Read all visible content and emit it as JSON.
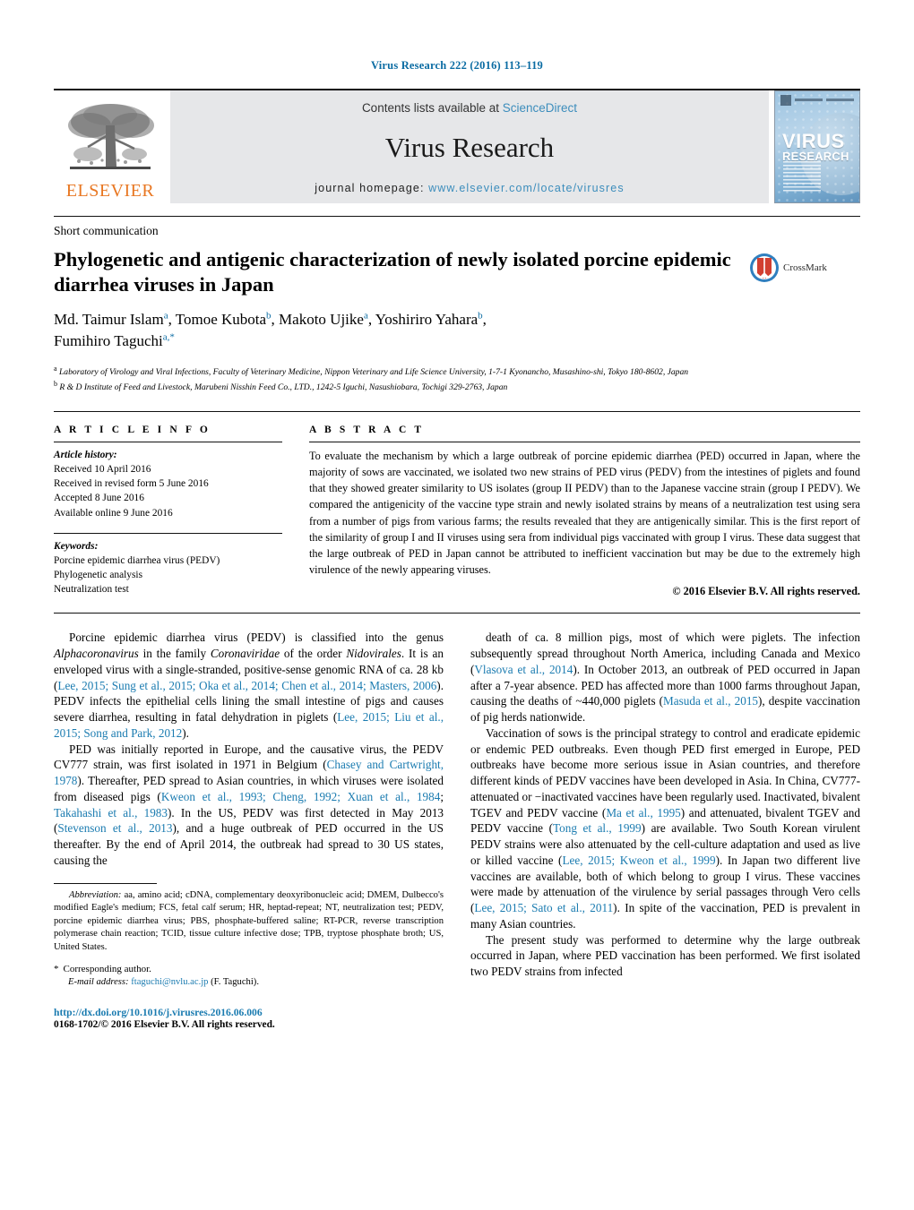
{
  "running_head": "Virus Research 222 (2016) 113–119",
  "masthead": {
    "publisher_name": "ELSEVIER",
    "contents_prefix": "Contents lists available at ",
    "contents_link": "ScienceDirect",
    "journal_title": "Virus Research",
    "homepage_prefix": "journal homepage: ",
    "homepage_link": "www.elsevier.com/locate/virusres",
    "cover_title_line1": "VIRUS",
    "cover_title_line2": "RESEARCH"
  },
  "article": {
    "doctype": "Short communication",
    "title": "Phylogenetic and antigenic characterization of newly isolated porcine epidemic diarrhea viruses in Japan",
    "crossmark_label": "CrossMark",
    "authors_line1": "Md. Taimur Islam",
    "authors_line1_sup1": "a",
    "authors_line1_b": ", Tomoe Kubota",
    "authors_line1_sup2": "b",
    "authors_line1_c": ", Makoto Ujike",
    "authors_line1_sup3": "a",
    "authors_line1_d": ", Yoshiriro Yahara",
    "authors_line1_sup4": "b",
    "authors_line1_e": ",",
    "authors_line2": "Fumihiro Taguchi",
    "authors_line2_sup": "a,*",
    "affiliation_a_sup": "a",
    "affiliation_a": "Laboratory of Virology and Viral Infections, Faculty of Veterinary Medicine, Nippon Veterinary and Life Science University, 1-7-1 Kyonancho, Musashino-shi, Tokyo 180-8602, Japan",
    "affiliation_b_sup": "b",
    "affiliation_b": "R & D Institute of Feed and Livestock, Marubeni Nisshin Feed Co., LTD., 1242-5 Iguchi, Nasushiobara, Tochigi 329-2763, Japan"
  },
  "article_info": {
    "label": "A R T I C L E    I N F O",
    "history_label": "Article history:",
    "history": [
      "Received 10 April 2016",
      "Received in revised form 5 June 2016",
      "Accepted 8 June 2016",
      "Available online 9 June 2016"
    ],
    "keywords_label": "Keywords:",
    "keywords": [
      "Porcine epidemic diarrhea virus (PEDV)",
      "Phylogenetic analysis",
      "Neutralization test"
    ]
  },
  "abstract": {
    "label": "A B S T R A C T",
    "text": "To evaluate the mechanism by which a large outbreak of porcine epidemic diarrhea (PED) occurred in Japan, where the majority of sows are vaccinated, we isolated two new strains of PED virus (PEDV) from the intestines of piglets and found that they showed greater similarity to US isolates (group II PEDV) than to the Japanese vaccine strain (group I PEDV). We compared the antigenicity of the vaccine type strain and newly isolated strains by means of a neutralization test using sera from a number of pigs from various farms; the results revealed that they are antigenically similar. This is the first report of the similarity of group I and II viruses using sera from individual pigs vaccinated with group I virus. These data suggest that the large outbreak of PED in Japan cannot be attributed to inefficient vaccination but may be due to the extremely high virulence of the newly appearing viruses.",
    "copyright": "© 2016 Elsevier B.V. All rights reserved."
  },
  "body": {
    "left": [
      {
        "parts": [
          {
            "t": "Porcine epidemic diarrhea virus (PEDV) is classified into the genus ",
            "k": "plain"
          },
          {
            "t": "Alphacoronavirus",
            "k": "ital"
          },
          {
            "t": " in the family ",
            "k": "plain"
          },
          {
            "t": "Coronaviridae",
            "k": "ital"
          },
          {
            "t": " of the order ",
            "k": "plain"
          },
          {
            "t": "Nidovirales",
            "k": "ital"
          },
          {
            "t": ". It is an enveloped virus with a single-stranded, positive-sense genomic RNA of ca. 28 kb (",
            "k": "plain"
          },
          {
            "t": "Lee, 2015; Sung et al., 2015; Oka et al., 2014; Chen et al., 2014; Masters, 2006",
            "k": "cite"
          },
          {
            "t": "). PEDV infects the epithelial cells lining the small intestine of pigs and causes severe diarrhea, resulting in fatal dehydration in piglets (",
            "k": "plain"
          },
          {
            "t": "Lee, 2015; Liu et al., 2015; Song and Park, 2012",
            "k": "cite"
          },
          {
            "t": ").",
            "k": "plain"
          }
        ]
      },
      {
        "parts": [
          {
            "t": "PED was initially reported in Europe, and the causative virus, the PEDV CV777 strain, was first isolated in 1971 in Belgium (",
            "k": "plain"
          },
          {
            "t": "Chasey and Cartwright, 1978",
            "k": "cite"
          },
          {
            "t": "). Thereafter, PED spread to Asian countries, in which viruses were isolated from diseased pigs (",
            "k": "plain"
          },
          {
            "t": "Kweon et al., 1993; Cheng, 1992; Xuan et al., 1984",
            "k": "cite"
          },
          {
            "t": "; ",
            "k": "plain"
          },
          {
            "t": "Takahashi et al., 1983",
            "k": "cite"
          },
          {
            "t": "). In the US, PEDV was first detected in May 2013 (",
            "k": "plain"
          },
          {
            "t": "Stevenson et al., 2013",
            "k": "cite"
          },
          {
            "t": "), and a huge outbreak of PED occurred in the US thereafter. By the end of April 2014, the outbreak had spread to 30 US states, causing the",
            "k": "plain"
          }
        ]
      }
    ],
    "right": [
      {
        "parts": [
          {
            "t": "death of ca. 8 million pigs, most of which were piglets. The infection subsequently spread throughout North America, including Canada and Mexico (",
            "k": "plain"
          },
          {
            "t": "Vlasova et al., 2014",
            "k": "cite"
          },
          {
            "t": "). In October 2013, an outbreak of PED occurred in Japan after a 7-year absence. PED has affected more than 1000 farms throughout Japan, causing the deaths of ~440,000 piglets (",
            "k": "plain"
          },
          {
            "t": "Masuda et al., 2015",
            "k": "cite"
          },
          {
            "t": "), despite vaccination of pig herds nationwide.",
            "k": "plain"
          }
        ],
        "noindent": false
      },
      {
        "parts": [
          {
            "t": "Vaccination of sows is the principal strategy to control and eradicate epidemic or endemic PED outbreaks. Even though PED first emerged in Europe, PED outbreaks have become more serious issue in Asian countries, and therefore different kinds of PEDV vaccines have been developed in Asia. In China, CV777-attenuated or −inactivated vaccines have been regularly used. Inactivated, bivalent TGEV and PEDV vaccine (",
            "k": "plain"
          },
          {
            "t": "Ma et al., 1995",
            "k": "cite"
          },
          {
            "t": ") and attenuated, bivalent TGEV and PEDV vaccine (",
            "k": "plain"
          },
          {
            "t": "Tong et al., 1999",
            "k": "cite"
          },
          {
            "t": ") are available. Two South Korean virulent PEDV strains were also attenuated by the cell-culture adaptation and used as live or killed vaccine (",
            "k": "plain"
          },
          {
            "t": "Lee, 2015; Kweon et al., 1999",
            "k": "cite"
          },
          {
            "t": "). In Japan two different live vaccines are available, both of which belong to group I virus. These vaccines were made by attenuation of the virulence by serial passages through Vero cells (",
            "k": "plain"
          },
          {
            "t": "Lee, 2015; Sato et al., 2011",
            "k": "cite"
          },
          {
            "t": "). In spite of the vaccination, PED is prevalent in many Asian countries.",
            "k": "plain"
          }
        ]
      },
      {
        "parts": [
          {
            "t": "The present study was performed to determine why the large outbreak occurred in Japan, where PED vaccination has been performed. We first isolated two PEDV strains from infected",
            "k": "plain"
          }
        ]
      }
    ]
  },
  "footnotes": {
    "abbreviation_label": "Abbreviation:",
    "abbreviation_text": "aa, amino acid; cDNA, complementary deoxyribonucleic acid; DMEM, Dulbecco's modified Eagle's medium; FCS, fetal calf serum; HR, heptad-repeat; NT, neutralization test; PEDV, porcine epidemic diarrhea virus; PBS, phosphate-buffered saline; RT-PCR, reverse transcription polymerase chain reaction; TCID, tissue culture infective dose; TPB, tryptose phosphate broth; US, United States.",
    "corresponding_star": "*",
    "corresponding_text": "Corresponding author.",
    "email_label": "E-mail address:",
    "email_link": "ftaguchi@nvlu.ac.jp",
    "email_suffix": "(F. Taguchi).",
    "doi": "http://dx.doi.org/10.1016/j.virusres.2016.06.006",
    "issn_line": "0168-1702/© 2016 Elsevier B.V. All rights reserved."
  },
  "colors": {
    "link": "#1a7bb0",
    "running_head": "#0b6ca3",
    "elsevier_orange": "#e87722",
    "banner_bg": "#e6e7e9"
  }
}
